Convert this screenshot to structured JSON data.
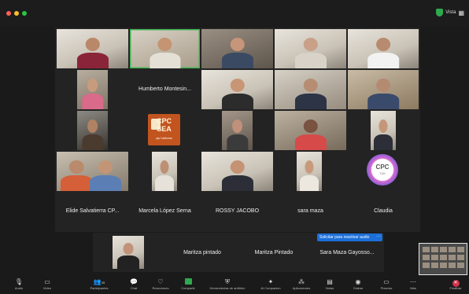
{
  "window": {
    "traffic_lights": [
      "#ff5f57",
      "#febc2e",
      "#28c840"
    ],
    "view_label": "Vista"
  },
  "participants": {
    "humberto": "Humberto Montesin...",
    "elide": "Elide Salvatierra CP...",
    "marcela": "Marcela López Serna",
    "rossy": "ROSSY JACOBO",
    "sara": "sara maza",
    "claudia": "Claudia",
    "maritza1": "Maritza pintado",
    "maritza2": "Maritza Pintado",
    "sara2": "Sara Maza Gayosso..."
  },
  "logos": {
    "cpc_line1": "CPC",
    "cpc_line2": "SEA",
    "cpc_line3": "aja California",
    "tab_line1": "CPC",
    "tab_line2": "TAB"
  },
  "audio_request": {
    "label": "Solicitar para reactivar audio",
    "more": "···"
  },
  "toolbar": {
    "audio": "Audio",
    "video": "Video",
    "participants": "Participantes",
    "participants_count": "25",
    "chat": "Chat",
    "reactions": "Reacciones",
    "share": "Compartir",
    "host_tools": "Herramientas de anfitrión",
    "ai_companion": "AI Companion",
    "apps": "Aplicaciones",
    "notes": "Notas",
    "record": "Grabar",
    "whiteboards": "Pizarras",
    "more": "Más",
    "end": "Finalizar"
  },
  "colors": {
    "active_speaker": "#3fb654",
    "share_green": "#2fa84f",
    "end_red": "#d3304a",
    "audio_blue": "#1c6fd9"
  }
}
